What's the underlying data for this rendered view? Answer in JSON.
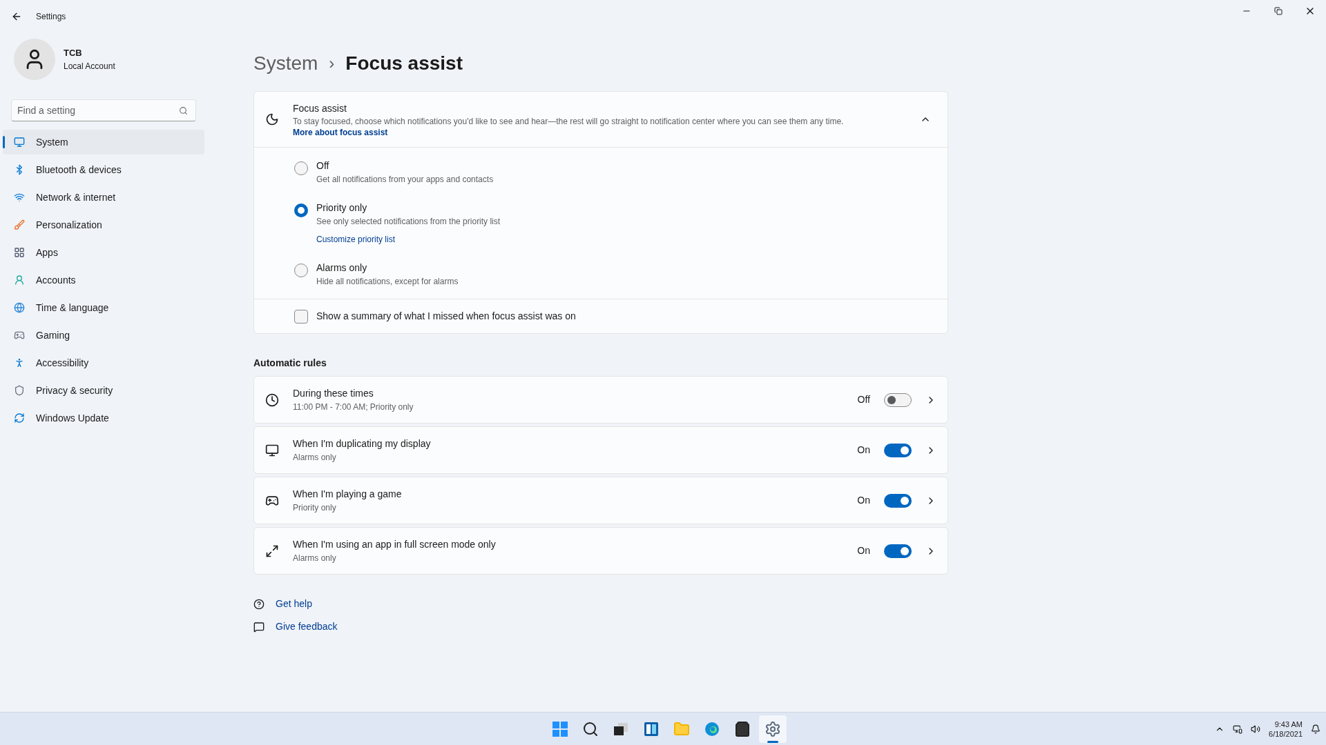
{
  "window": {
    "title": "Settings"
  },
  "account": {
    "name": "TCB",
    "type": "Local Account"
  },
  "search": {
    "placeholder": "Find a setting"
  },
  "nav": [
    {
      "label": "System",
      "selected": true
    },
    {
      "label": "Bluetooth & devices",
      "selected": false
    },
    {
      "label": "Network & internet",
      "selected": false
    },
    {
      "label": "Personalization",
      "selected": false
    },
    {
      "label": "Apps",
      "selected": false
    },
    {
      "label": "Accounts",
      "selected": false
    },
    {
      "label": "Time & language",
      "selected": false
    },
    {
      "label": "Gaming",
      "selected": false
    },
    {
      "label": "Accessibility",
      "selected": false
    },
    {
      "label": "Privacy & security",
      "selected": false
    },
    {
      "label": "Windows Update",
      "selected": false
    }
  ],
  "breadcrumb": {
    "parent": "System",
    "separator": "›",
    "current": "Focus assist"
  },
  "focus_card": {
    "title": "Focus assist",
    "description": "To stay focused, choose which notifications you'd like to see and hear—the rest will go straight to notification center where you can see them any time.",
    "link": "More about focus assist",
    "expanded": true,
    "options": [
      {
        "label": "Off",
        "description": "Get all notifications from your apps and contacts",
        "selected": false
      },
      {
        "label": "Priority only",
        "description": "See only selected notifications from the priority list",
        "link": "Customize priority list",
        "selected": true
      },
      {
        "label": "Alarms only",
        "description": "Hide all notifications, except for alarms",
        "selected": false
      }
    ],
    "summary": {
      "label": "Show a summary of what I missed when focus assist was on",
      "checked": false
    }
  },
  "rules_heading": "Automatic rules",
  "rules": [
    {
      "title": "During these times",
      "subtitle": "11:00 PM - 7:00 AM; Priority only",
      "state_label": "Off",
      "on": false
    },
    {
      "title": "When I'm duplicating my display",
      "subtitle": "Alarms only",
      "state_label": "On",
      "on": true
    },
    {
      "title": "When I'm playing a game",
      "subtitle": "Priority only",
      "state_label": "On",
      "on": true
    },
    {
      "title": "When I'm using an app in full screen mode only",
      "subtitle": "Alarms only",
      "state_label": "On",
      "on": true
    }
  ],
  "help_links": [
    {
      "label": "Get help"
    },
    {
      "label": "Give feedback"
    }
  ],
  "taskbar": {
    "apps": [
      {
        "selected": false
      },
      {
        "selected": false
      },
      {
        "selected": false
      },
      {
        "selected": false
      },
      {
        "selected": false
      },
      {
        "selected": false
      },
      {
        "selected": false
      },
      {
        "selected": true
      }
    ],
    "time": "9:43 AM",
    "date": "6/18/2021"
  }
}
